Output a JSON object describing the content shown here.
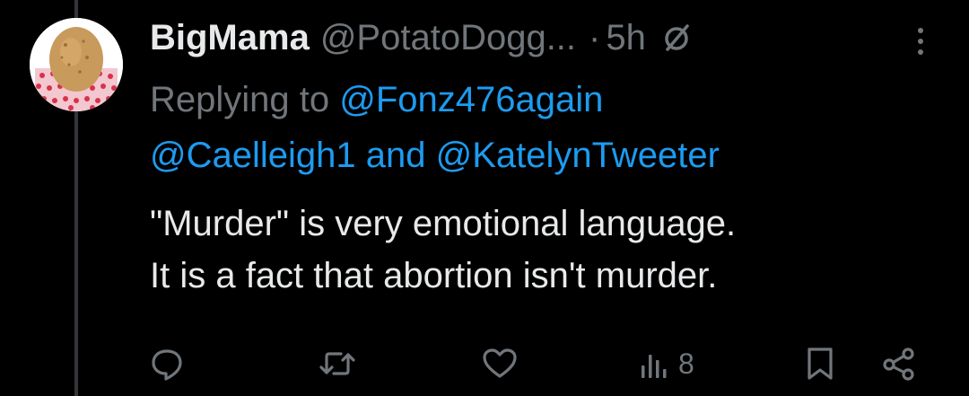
{
  "author": {
    "display_name": "BigMama",
    "handle": "@PotatoDogg...",
    "separator": "·",
    "timestamp": "5h"
  },
  "reply_context": {
    "prefix": "Replying to",
    "mention_1": "@Fonz476again",
    "mention_2": "@Caelleigh1",
    "joiner": "and",
    "mention_3": "@KatelynTweeter"
  },
  "tweet": {
    "line_1": "\"Murder\" is very emotional language.",
    "line_2": "It is a fact that abortion isn't murder."
  },
  "actions": {
    "reply_icon": "reply-icon",
    "retweet_icon": "retweet-icon",
    "like_icon": "heart-icon",
    "views_icon": "views-icon",
    "views_count": "8",
    "bookmark_icon": "bookmark-icon",
    "share_icon": "share-icon"
  },
  "colors": {
    "background": "#000000",
    "text": "#e7e9ea",
    "muted": "#71767b",
    "link": "#1d9bf0",
    "thread_line": "#333639"
  }
}
